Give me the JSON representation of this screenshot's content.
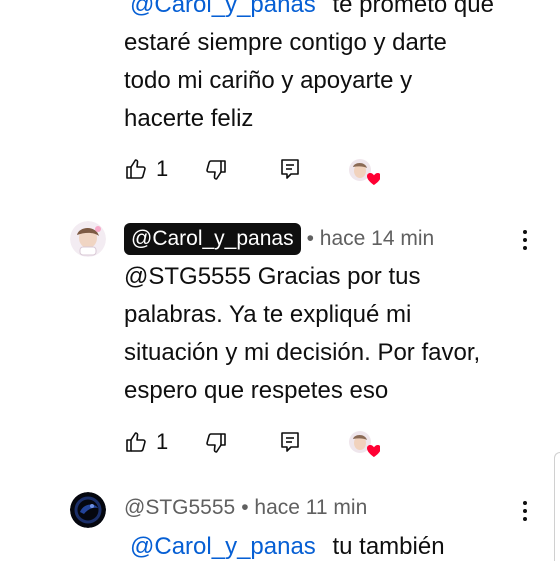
{
  "comment1": {
    "mention": "@Carol_y_panas",
    "text_line1": "te prometo que",
    "text_line2": "estaré siempre contigo y darte",
    "text_line3": "todo mi cariño y apoyarte y",
    "text_line4": "hacerte feliz",
    "like_count": "1"
  },
  "comment2": {
    "author": "@Carol_y_panas",
    "time": "• hace 14 min",
    "lines": [
      "@STG5555 Gracias por tus",
      "palabras. Ya te expliqué mi",
      "situación y mi decisión. Por favor,",
      "espero que respetes eso"
    ],
    "like_count": "1"
  },
  "comment3": {
    "author": "@STG5555",
    "time": "• hace 11 min",
    "mention": "@Carol_y_panas",
    "text_start": "tu también"
  },
  "icons": {
    "like": "thumbs-up-icon",
    "dislike": "thumbs-down-icon",
    "reply": "reply-comment-icon",
    "creator_heart": "creator-heart-avatar-icon",
    "more": "more-vertical-icon"
  },
  "colors": {
    "mention": "#065fd4",
    "heart": "#ff0033",
    "meta_text": "#606060"
  }
}
